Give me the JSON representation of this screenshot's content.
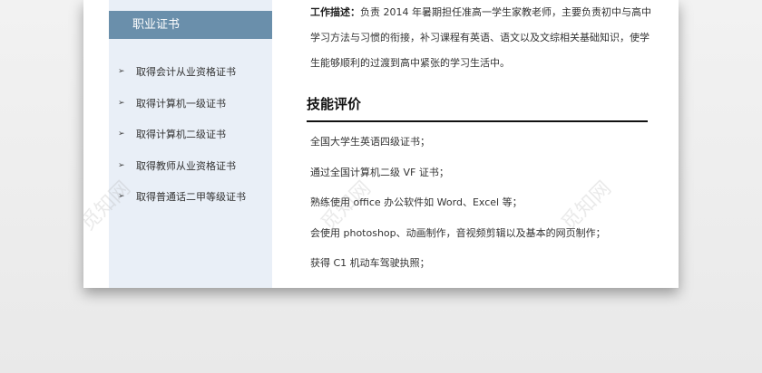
{
  "sidebar": {
    "heading": "职业证书",
    "items": [
      {
        "label": "取得会计从业资格证书"
      },
      {
        "label": "取得计算机一级证书"
      },
      {
        "label": "取得计算机二级证书"
      },
      {
        "label": "取得教师从业资格证书"
      },
      {
        "label": "取得普通话二甲等级证书"
      }
    ],
    "bullet_glyph": "➢"
  },
  "work": {
    "label": "工作描述：",
    "text": "负责 2014 年暑期担任准高一学生家教老师，主要负责初中与高中学习方法与习惯的衔接，补习课程有英语、语文以及文综相关基础知识，使学生能够顺利的过渡到高中紧张的学习生活中。"
  },
  "skills": {
    "title": "技能评价",
    "items": [
      "全国大学生英语四级证书；",
      "通过全国计算机二级 VF 证书；",
      "熟练使用 office 办公软件如 Word、Excel 等；",
      "会使用 photoshop、动画制作，音视频剪辑以及基本的网页制作；",
      "获得 C1 机动车驾驶执照；"
    ]
  },
  "watermark": {
    "text": "觅知网"
  },
  "colors": {
    "sidebar_bg": "#e9eff7",
    "heading_bg": "#6a8fab",
    "rule": "#111111"
  }
}
